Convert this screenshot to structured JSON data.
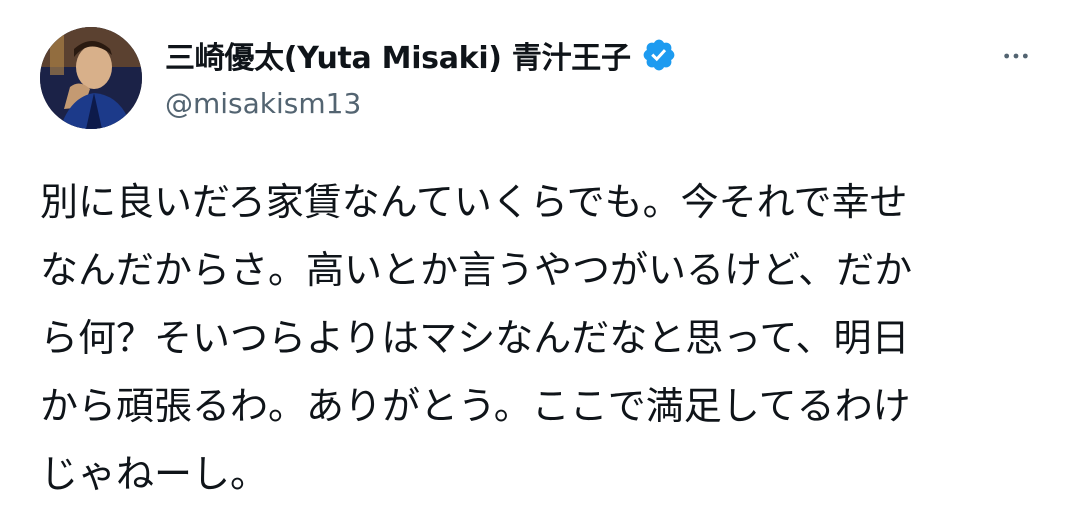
{
  "author": {
    "display_name": "三崎優太(Yuta Misaki) 青汁王子",
    "handle": "@misakism13",
    "verified": true,
    "verified_color": "#1d9bf0"
  },
  "actions": {
    "more_icon": "more-horizontal-icon"
  },
  "tweet": {
    "lines": [
      "別に良いだろ家賃なんていくらでも。今それで幸せ",
      "なんだからさ。高いとか言うやつがいるけど、だか",
      "ら何？そいつらよりはマシなんだなと思って、明日",
      "から頑張るわ。ありがとう。ここで満足してるわけ",
      "じゃねーし。"
    ]
  },
  "colors": {
    "text": "#0f1419",
    "secondary": "#536471",
    "background": "#ffffff"
  }
}
